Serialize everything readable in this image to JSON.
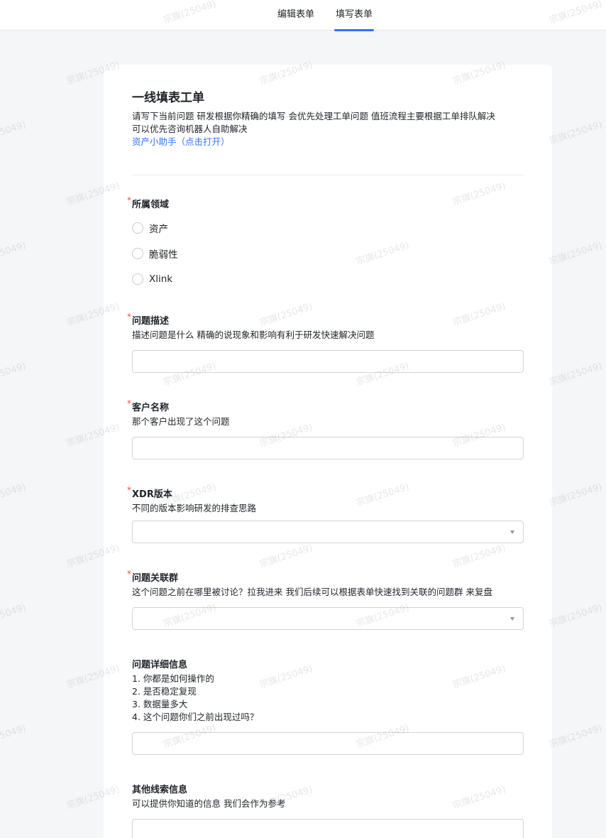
{
  "tabs": [
    {
      "label": "编辑表单"
    },
    {
      "label": "填写表单"
    }
  ],
  "form": {
    "title": "一线填表工单",
    "description_line1": "请写下当前问题 研发根据你精确的填写 会优先处理工单问题 值班流程主要根据工单排队解决",
    "description_line2": "可以优先咨询机器人自助解决",
    "assistant_link": "资产小助手（点击打开）"
  },
  "questions": {
    "domain": {
      "title": "所属领域",
      "required": "*",
      "options": [
        "资产",
        "脆弱性",
        "Xlink"
      ]
    },
    "problem": {
      "title": "问题描述",
      "required": "*",
      "desc": "描述问题是什么 精确的说现象和影响有利于研发快速解决问题"
    },
    "customer": {
      "title": "客户名称",
      "required": "*",
      "desc": "那个客户出现了这个问题"
    },
    "version": {
      "title": "XDR版本",
      "required": "*",
      "desc": "不同的版本影响研发的排查思路"
    },
    "group": {
      "title": "问题关联群",
      "required": "*",
      "desc": "这个问题之前在哪里被讨论？拉我进来 我们后续可以根据表单快速找到关联的问题群 来复盘"
    },
    "details": {
      "title": "问题详细信息",
      "lines": [
        "1. 你都是如何操作的",
        "2. 是否稳定复现",
        "3. 数据量多大",
        "4. 这个问题你们之前出现过吗？"
      ]
    },
    "clues": {
      "title": "其他线索信息",
      "desc": "可以提供你知道的信息 我们会作为参考"
    }
  },
  "watermark": "宗旗(25049)",
  "colors": {
    "accent": "#3370ff",
    "required": "#f54a45",
    "page_bg": "#f5f6f8"
  }
}
